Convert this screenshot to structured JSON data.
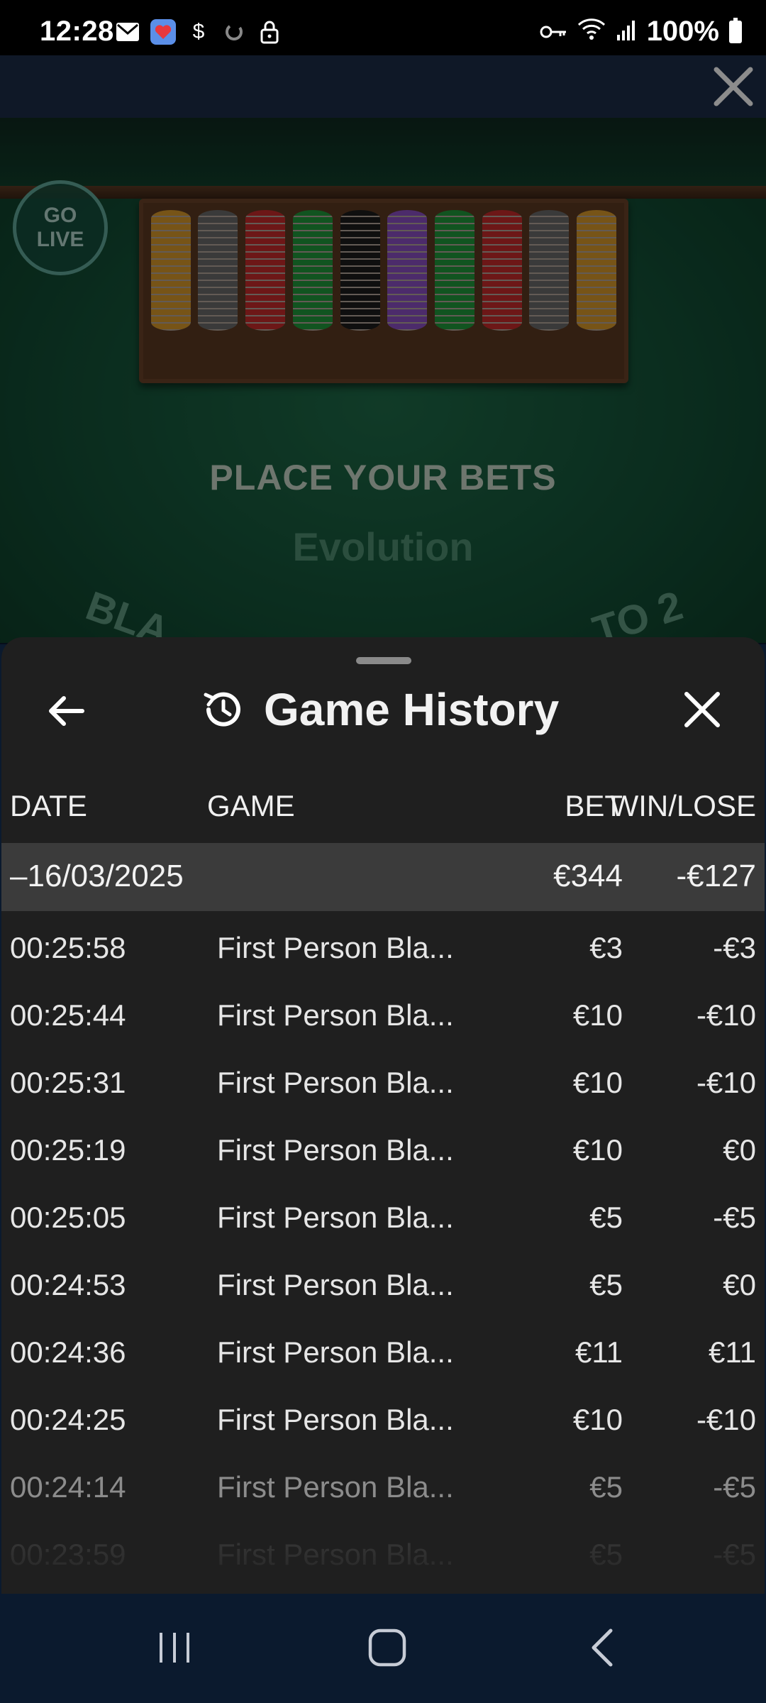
{
  "status_bar": {
    "time": "12:28",
    "battery": "100%",
    "left_icons": [
      "mail-icon",
      "heart-app-icon",
      "dollar-icon",
      "sync-icon",
      "lock-icon"
    ],
    "right_icons": [
      "key-icon",
      "wifi-icon",
      "signal-icon",
      "battery-icon"
    ]
  },
  "game": {
    "go_live_line1": "GO",
    "go_live_line2": "LIVE",
    "place_bets": "PLACE YOUR BETS",
    "brand": "Evolution",
    "arc_left": "BLA",
    "arc_right": "TO 2"
  },
  "sheet": {
    "title": "Game History",
    "columns": {
      "date": "DATE",
      "game": "GAME",
      "bet": "BET",
      "win_lose": "WIN/LOSE"
    },
    "summary": {
      "date": "–16/03/2025",
      "bet": "€344",
      "win_lose": "-€127"
    },
    "rows": [
      {
        "time": "00:25:58",
        "game": "First Person Bla...",
        "bet": "€3",
        "win_lose": "-€3"
      },
      {
        "time": "00:25:44",
        "game": "First Person Bla...",
        "bet": "€10",
        "win_lose": "-€10"
      },
      {
        "time": "00:25:31",
        "game": "First Person Bla...",
        "bet": "€10",
        "win_lose": "-€10"
      },
      {
        "time": "00:25:19",
        "game": "First Person Bla...",
        "bet": "€10",
        "win_lose": "€0"
      },
      {
        "time": "00:25:05",
        "game": "First Person Bla...",
        "bet": "€5",
        "win_lose": "-€5"
      },
      {
        "time": "00:24:53",
        "game": "First Person Bla...",
        "bet": "€5",
        "win_lose": "€0"
      },
      {
        "time": "00:24:36",
        "game": "First Person Bla...",
        "bet": "€11",
        "win_lose": "€11"
      },
      {
        "time": "00:24:25",
        "game": "First Person Bla...",
        "bet": "€10",
        "win_lose": "-€10"
      },
      {
        "time": "00:24:14",
        "game": "First Person Bla...",
        "bet": "€5",
        "win_lose": "-€5"
      },
      {
        "time": "00:23:59",
        "game": "First Person Bla...",
        "bet": "€5",
        "win_lose": "-€5"
      }
    ]
  },
  "colors": {
    "sheet_bg": "#1f1f1f",
    "summary_bg": "#3b3b3b",
    "table_green": "#145238",
    "topbar": "#1c2d47",
    "navbar": "#0b1a2e"
  },
  "chips": [
    "#d99a2b",
    "#6a6a6a",
    "#c62a2a",
    "#1f9a3b",
    "#1c1c1c",
    "#8a4fc4",
    "#1f9a3b",
    "#c62a2a",
    "#6a6a6a",
    "#d99a2b"
  ],
  "nav": [
    "recent-apps-icon",
    "home-icon",
    "back-icon"
  ]
}
